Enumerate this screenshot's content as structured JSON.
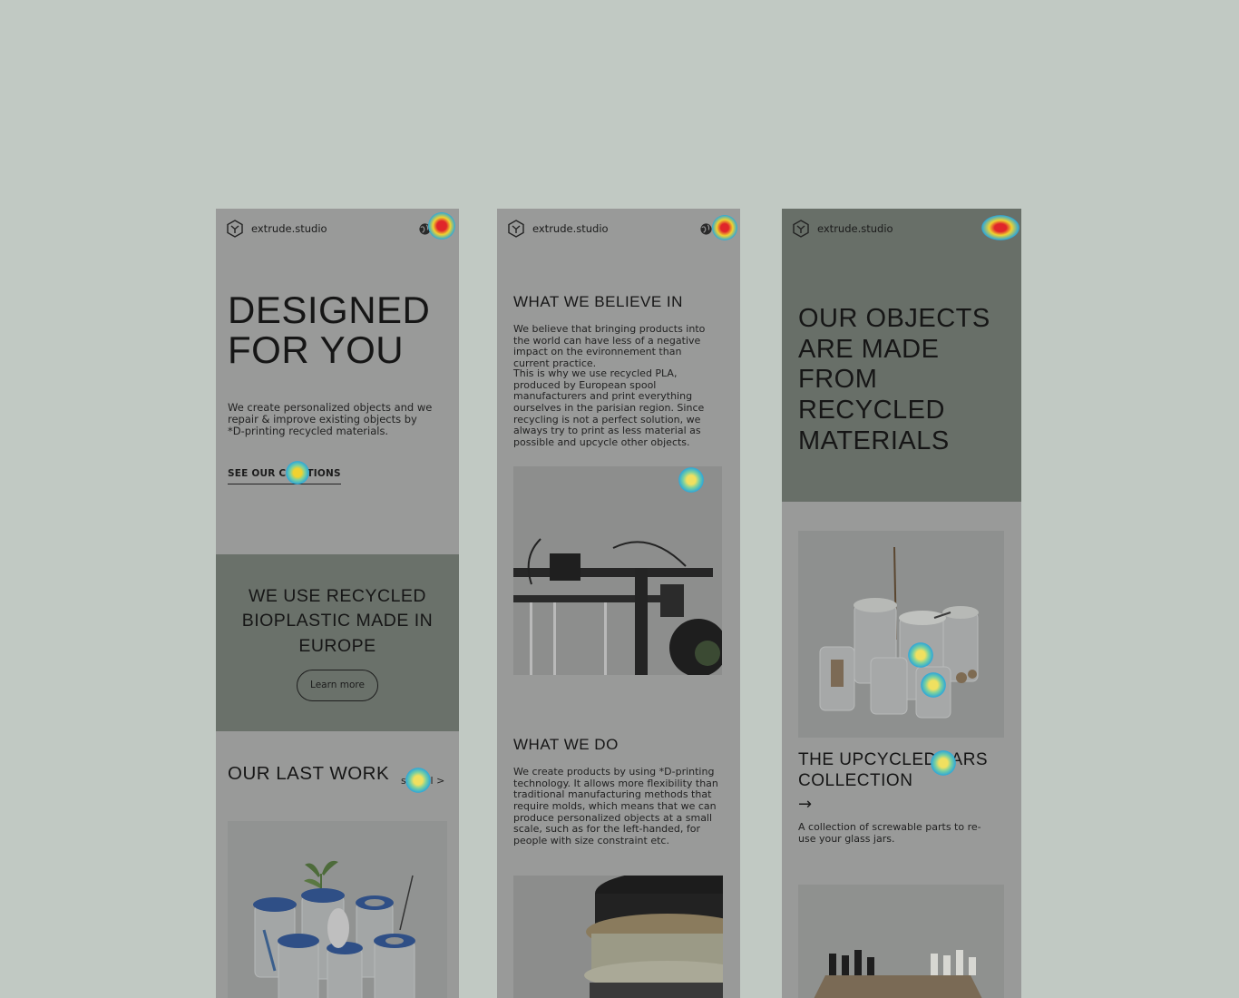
{
  "screen1": {
    "brand": "extrude.studio",
    "hero_title": "DESIGNED FOR YOU",
    "hero_text": "We create personalized objects and we repair & improve existing objects by *D-printing recycled materials.",
    "cta": "SEE OUR CREATIONS",
    "band_title": "WE USE RECYCLED BIOPLASTIC MADE IN EUROPE",
    "learn_more": "Learn more",
    "last_work_title": "OUR LAST WORK",
    "see_all": "see all >"
  },
  "screen2": {
    "brand": "extrude.studio",
    "believe_title": "WHAT WE BELIEVE IN",
    "believe_p1": "We believe that bringing products into the world can have less of a negative impact on the evironnement than current practice.",
    "believe_p2": "This is why we use recycled PLA, produced by European spool manufacturers and print everything ourselves in the parisian region. Since recycling is not a perfect solution, we always try to print as less material as possible and upcycle other objects.",
    "do_title": "WHAT WE DO",
    "do_p": "We create products by using *D-printing technology. It allows more flexibility than traditional manufacturing methods that require molds, which means that we can produce personalized objects at a small scale, such as for the left-handed, for people with size constraint etc."
  },
  "screen3": {
    "brand": "extrude.studio",
    "band_title": "OUR OBJECTS ARE MADE FROM RECYCLED MATERIALS",
    "collection_title": "THE UPCYCLED JARS COLLECTION",
    "arrow": "→",
    "collection_desc": "A collection of screwable parts to re-use your glass jars."
  },
  "colors": {
    "page_bg": "#c1c9c3",
    "screen_bg": "#999a99",
    "band_bg": "#6a716a",
    "jar_lid": "#2f4f86",
    "heat_hot": "#e0262a",
    "heat_cool": "#30a9d6"
  },
  "icons": [
    "logo-icon",
    "globe-icon",
    "menu-icon",
    "arrow-right-icon"
  ]
}
